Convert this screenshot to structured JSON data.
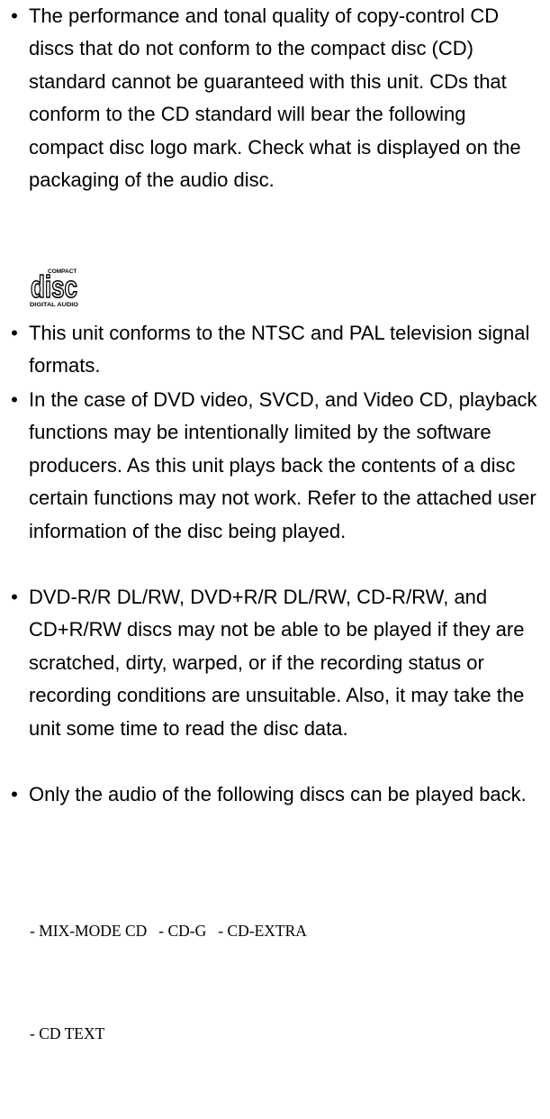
{
  "bullet_symbol": "•",
  "paragraphs": [
    "The performance and tonal quality of copy-control CD discs that do not conform to the compact disc (CD) standard cannot be guaranteed with this unit. CDs that conform to the CD standard will bear the following compact disc logo mark. Check what is displayed on the packaging of the audio disc.",
    "This unit conforms to the NTSC and PAL television signal formats.",
    "In the case of DVD video, SVCD, and Video CD, playback functions may be intentionally limited by the software producers. As this unit plays back the contents of a disc certain functions may not work. Refer to the attached user information of the disc being played.",
    "DVD-R/R DL/RW, DVD+R/R DL/RW, CD-R/RW, and CD+R/RW discs may not be able to be played if they are scratched, dirty, warped, or if the recording status or recording conditions are unsuitable. Also, it may take the unit some time to read the disc data.",
    "Only the audio of the following discs can be played back."
  ],
  "logo": {
    "top_text": "COMPACT",
    "main_text": "disc",
    "bottom_text": "DIGITAL AUDIO"
  },
  "disc_types": [
    "- MIX-MODE CD",
    "- CD-G",
    "- CD-EXTRA",
    "- CD TEXT"
  ]
}
